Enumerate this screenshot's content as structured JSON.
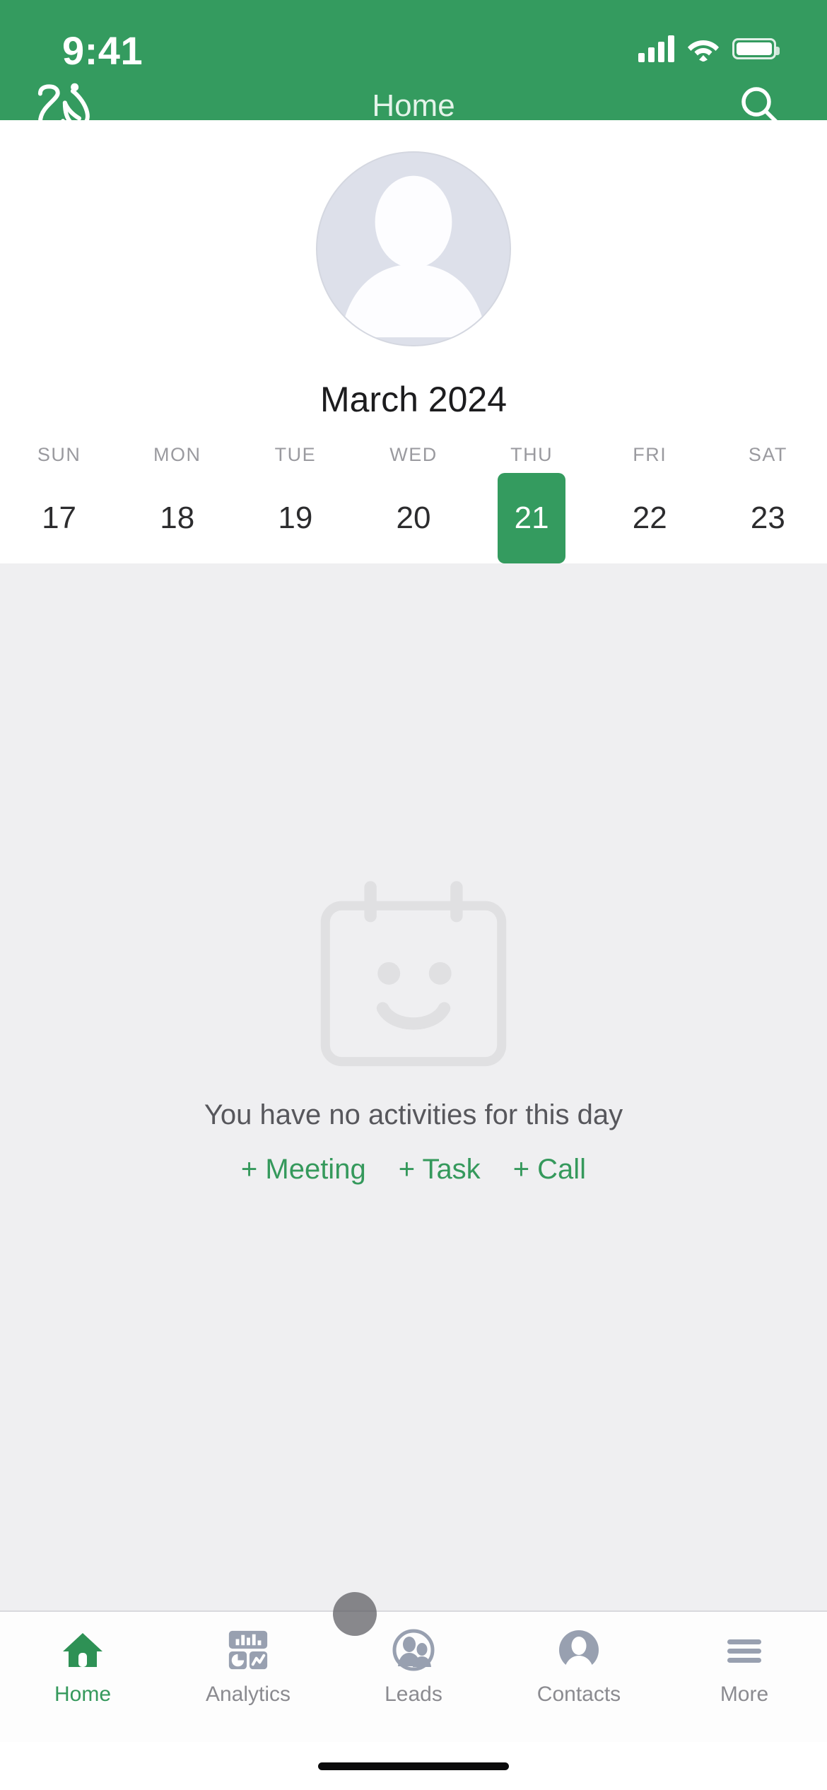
{
  "status_bar": {
    "time": "9:41",
    "cellular_icon": "signal-bars-icon",
    "wifi_icon": "wifi-icon",
    "battery_icon": "battery-icon"
  },
  "header": {
    "logo_name": "zia-logo",
    "title": "Home",
    "search_icon": "search-icon",
    "background_color": "#349B5F"
  },
  "profile": {
    "avatar_name": "user-avatar-placeholder"
  },
  "calendar": {
    "month_label": "March 2024",
    "weekdays": [
      "SUN",
      "MON",
      "TUE",
      "WED",
      "THU",
      "FRI",
      "SAT"
    ],
    "dates": [
      {
        "day": "17",
        "selected": false
      },
      {
        "day": "18",
        "selected": false
      },
      {
        "day": "19",
        "selected": false
      },
      {
        "day": "20",
        "selected": false
      },
      {
        "day": "21",
        "selected": true
      },
      {
        "day": "22",
        "selected": false
      },
      {
        "day": "23",
        "selected": false
      }
    ],
    "selected_date": "21",
    "selected_color": "#349B5F"
  },
  "empty_state": {
    "illustration": "calendar-smiley-icon",
    "message": "You have no activities for this day",
    "actions": [
      {
        "label": "+ Meeting",
        "name": "add-meeting-link"
      },
      {
        "label": "+ Task",
        "name": "add-task-link"
      },
      {
        "label": "+ Call",
        "name": "add-call-link"
      }
    ],
    "action_color": "#35995C"
  },
  "tab_bar": {
    "items": [
      {
        "label": "Home",
        "icon": "home-icon",
        "active": true
      },
      {
        "label": "Analytics",
        "icon": "analytics-dashboard-icon",
        "active": false
      },
      {
        "label": "Leads",
        "icon": "leads-people-icon",
        "active": false
      },
      {
        "label": "Contacts",
        "icon": "contact-person-icon",
        "active": false
      },
      {
        "label": "More",
        "icon": "hamburger-menu-icon",
        "active": false
      }
    ],
    "active_color": "#35995C",
    "inactive_color": "#8b8b90"
  }
}
